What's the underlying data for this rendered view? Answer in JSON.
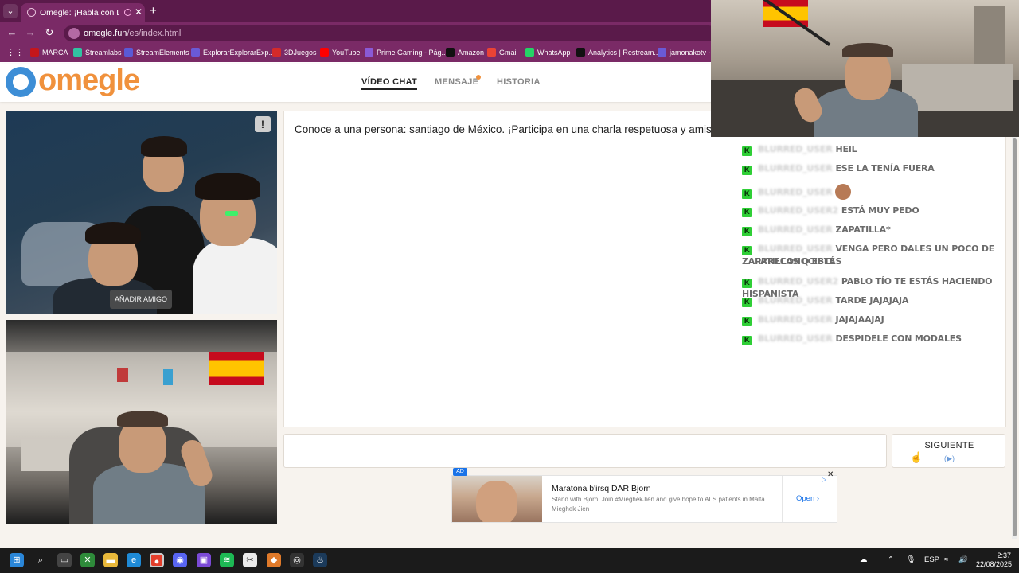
{
  "browser": {
    "tab_title": "Omegle: ¡Habla con Descon",
    "url_domain": "omegle.fun",
    "url_path": "/es/index.html",
    "new_tab": "+",
    "back": "←",
    "forward": "→",
    "reload": "↻",
    "bookmarks": [
      {
        "label": "MARCA",
        "color": "#c4161c"
      },
      {
        "label": "Streamlabs",
        "color": "#31c3a2"
      },
      {
        "label": "StreamElements",
        "color": "#5a5ad6"
      },
      {
        "label": "ExplorarExplorarExp...",
        "color": "#6a5ad6"
      },
      {
        "label": "3DJuegos",
        "color": "#d42a2a"
      },
      {
        "label": "YouTube",
        "color": "#ff0000"
      },
      {
        "label": "Prime Gaming - Pág...",
        "color": "#8a5ad6"
      },
      {
        "label": "Amazon",
        "color": "#111111"
      },
      {
        "label": "Gmail",
        "color": "#ea4335"
      },
      {
        "label": "WhatsApp",
        "color": "#25d366"
      },
      {
        "label": "Analytics | Restream...",
        "color": "#111111"
      },
      {
        "label": "jamonakotv - T",
        "color": "#6a5ad6"
      }
    ]
  },
  "site": {
    "logo": "omegle",
    "nav": {
      "video_chat": "VÍDEO CHAT",
      "message": "MENSAJE",
      "history": "HISTORIA"
    },
    "add_friend": "AÑADIR AMIGO",
    "report": "!",
    "chat_intro": "Conoce a una persona: santiago de México. ¡Participa en una charla respetuosa y amistosa!",
    "input_value": "",
    "next_label": "SIGUIENTE",
    "next_hint": "(▶)"
  },
  "ad": {
    "badge": "AD",
    "title": "Maratona b'irsq DAR Bjorn",
    "description": "Stand with Bjorn. Join #MieghekJien and give hope to ALS patients in Malta Mieghek Jien",
    "cta": "Open",
    "close": "✕",
    "adchoices": "▷"
  },
  "stream_chat": [
    {
      "user": "blurred_user",
      "message": "HEIL"
    },
    {
      "user": "blurred_user",
      "message": "ESE LA TENÍA FUERA"
    },
    {
      "user": "blurred_user",
      "message": ""
    },
    {
      "user": "blurred_user2",
      "message": "ESTÁ MUY PEDO"
    },
    {
      "user": "blurred_user",
      "message": "ZAPATILLA*"
    },
    {
      "user": "blurred_user",
      "message": "VENGA PERO DALES UN POCO DE ZAPATILLAS Q ESTÁS"
    },
    {
      "user": "",
      "message": "IRRECONOCIBLE"
    },
    {
      "user": "blurred_user2",
      "message": "PABLO TÍO TE ESTÁS HACIENDO HISPANISTA"
    },
    {
      "user": "blurred_user",
      "message": "TARDE JAJAJAJA"
    },
    {
      "user": "blurred_user",
      "message": "JAJAJAAJAJ"
    },
    {
      "user": "blurred_user",
      "message": "DESPIDELE CON MODALES"
    }
  ],
  "taskbar": {
    "time": "2:37",
    "date": "22/08/2025",
    "lang": "ESP"
  },
  "colors": {
    "brand_orange": "#f0913c",
    "brand_blue": "#3d8ed6",
    "browser_purple": "#7a2a66",
    "chat_badge": "#2fcf36"
  }
}
